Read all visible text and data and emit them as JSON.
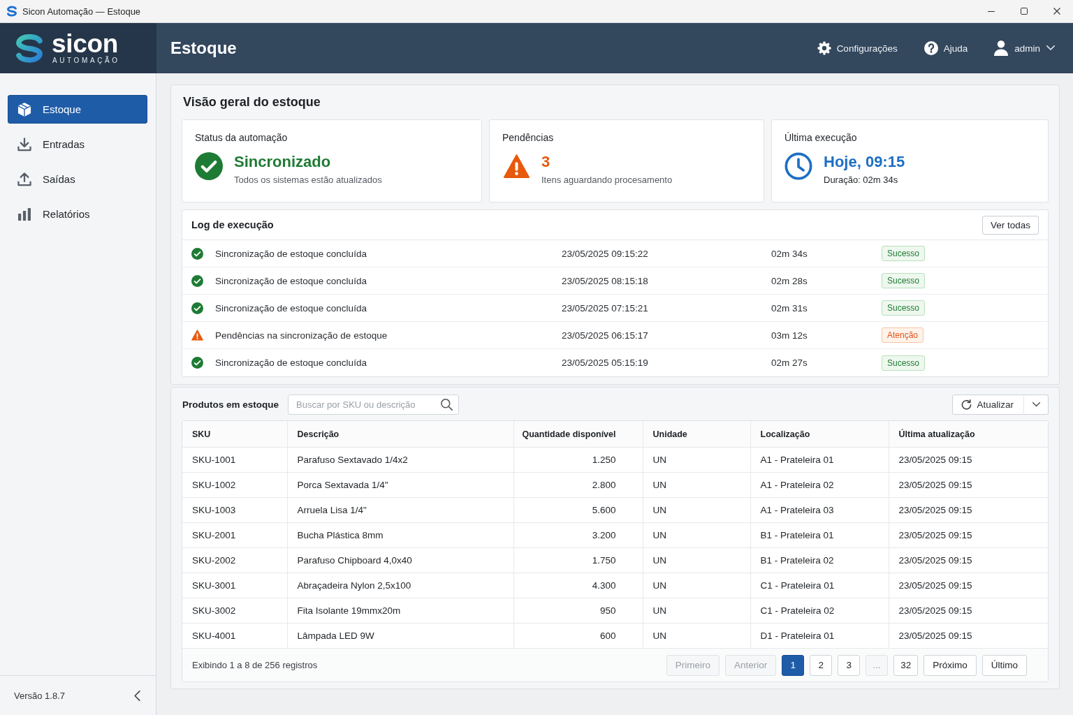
{
  "window": {
    "title": "Sicon Automação — Estoque"
  },
  "header": {
    "brand": {
      "name": "sicon",
      "tagline": "AUTOMAÇÃO"
    },
    "title": "Estoque",
    "actions": [
      {
        "kind": "settings",
        "label": "Configurações"
      },
      {
        "kind": "help",
        "label": "Ajuda"
      }
    ],
    "user": {
      "name": "admin"
    }
  },
  "sidebar": {
    "items": [
      {
        "kind": "inventory",
        "label": "Estoque",
        "selected": true
      },
      {
        "kind": "inbound",
        "label": "Entradas",
        "selected": false
      },
      {
        "kind": "outbound",
        "label": "Saídas",
        "selected": false
      },
      {
        "kind": "reports",
        "label": "Relatórios",
        "selected": false
      }
    ],
    "version": "Versão 1.8.7"
  },
  "overview": {
    "title": "Visão geral do estoque",
    "cards": [
      {
        "kind": "success",
        "label": "Status da automação",
        "value": "Sincronizado",
        "detail": "Todos os sistemas estão atualizados"
      },
      {
        "kind": "warning",
        "label": "Pendências",
        "value": "3",
        "detail": "Itens aguardando procesamento"
      },
      {
        "kind": "time",
        "label": "Última execução",
        "value": "Hoje, 09:15",
        "detail": "Duração: 02m 34s"
      }
    ],
    "log": {
      "title": "Log de execução",
      "button": "Ver todas",
      "rows": [
        {
          "kind": "success",
          "message": "Sincronização de estoque concluída",
          "timestamp": "23/05/2025 09:15:22",
          "duration": "02m 34s",
          "badge": "Sucesso"
        },
        {
          "kind": "success",
          "message": "Sincronização de estoque concluída",
          "timestamp": "23/05/2025 08:15:18",
          "duration": "02m 28s",
          "badge": "Sucesso"
        },
        {
          "kind": "success",
          "message": "Sincronização de estoque concluída",
          "timestamp": "23/05/2025 07:15:21",
          "duration": "02m 31s",
          "badge": "Sucesso"
        },
        {
          "kind": "warning",
          "message": "Pendências na sincronização de estoque",
          "timestamp": "23/05/2025 06:15:17",
          "duration": "03m 12s",
          "badge": "Atenção"
        },
        {
          "kind": "success",
          "message": "Sincronização de estoque concluída",
          "timestamp": "23/05/2025 05:15:19",
          "duration": "02m 27s",
          "badge": "Sucesso"
        }
      ]
    }
  },
  "products": {
    "title": "Produtos em estoque",
    "search": {
      "placeholder": "Buscar por SKU ou descrição"
    },
    "refresh_button": "Atualizar",
    "table": {
      "columns": [
        "SKU",
        "Descrição",
        "Quantidade disponível",
        "Unidade",
        "Localização",
        "Última atualização"
      ],
      "rows": [
        [
          "SKU-1001",
          "Parafuso Sextavado 1/4x2",
          "1.250",
          "UN",
          "A1 - Prateleira 01",
          "23/05/2025 09:15"
        ],
        [
          "SKU-1002",
          "Porca Sextavada 1/4\"",
          "2.800",
          "UN",
          "A1 - Prateleira 02",
          "23/05/2025 09:15"
        ],
        [
          "SKU-1003",
          "Arruela Lisa 1/4\"",
          "5.600",
          "UN",
          "A1 - Prateleira 03",
          "23/05/2025 09:15"
        ],
        [
          "SKU-2001",
          "Bucha Plástica 8mm",
          "3.200",
          "UN",
          "B1 - Prateleira 01",
          "23/05/2025 09:15"
        ],
        [
          "SKU-2002",
          "Parafuso Chipboard 4,0x40",
          "1.750",
          "UN",
          "B1 - Prateleira 02",
          "23/05/2025 09:15"
        ],
        [
          "SKU-3001",
          "Abraçadeira Nylon 2,5x100",
          "4.300",
          "UN",
          "C1 - Prateleira 01",
          "23/05/2025 09:15"
        ],
        [
          "SKU-3002",
          "Fita Isolante 19mmx20m",
          "950",
          "UN",
          "C1 - Prateleira 02",
          "23/05/2025 09:15"
        ],
        [
          "SKU-4001",
          "Lâmpada LED 9W",
          "600",
          "UN",
          "D1 - Prateleira 01",
          "23/05/2025 09:15"
        ]
      ]
    },
    "summary": "Exibindo 1 a 8 de 256 registros",
    "pagination": [
      {
        "kind": "nav",
        "label": "Primeiro",
        "selected": false,
        "disabled": true
      },
      {
        "kind": "nav",
        "label": "Anterior",
        "selected": false,
        "disabled": true
      },
      {
        "kind": "page",
        "label": "1",
        "selected": true,
        "disabled": false
      },
      {
        "kind": "page",
        "label": "2",
        "selected": false,
        "disabled": false
      },
      {
        "kind": "page",
        "label": "3",
        "selected": false,
        "disabled": false
      },
      {
        "kind": "gap",
        "label": "...",
        "selected": false,
        "disabled": true
      },
      {
        "kind": "page",
        "label": "32",
        "selected": false,
        "disabled": false
      },
      {
        "kind": "nav",
        "label": "Próximo",
        "selected": false,
        "disabled": false
      },
      {
        "kind": "nav",
        "label": "Último",
        "selected": false,
        "disabled": false
      }
    ]
  }
}
